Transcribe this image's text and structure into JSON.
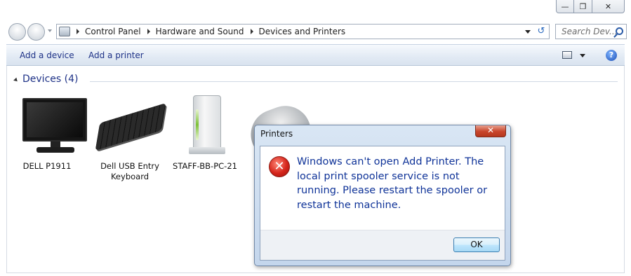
{
  "breadcrumb": [
    "Control Panel",
    "Hardware and Sound",
    "Devices and Printers"
  ],
  "search": {
    "placeholder": "Search Dev..."
  },
  "toolbar": {
    "add_device": "Add a device",
    "add_printer": "Add a printer"
  },
  "group": {
    "header": "Devices (4)"
  },
  "devices": [
    {
      "label": "DELL P1911",
      "icon": "monitor-icon"
    },
    {
      "label": "Dell USB Entry Keyboard",
      "icon": "keyboard-icon"
    },
    {
      "label": "STAFF-BB-PC-21",
      "icon": "computer-drive-icon"
    },
    {
      "label": "",
      "icon": "mouse-icon"
    }
  ],
  "dialog": {
    "title": "Printers",
    "message": "Windows can't open Add Printer. The local print spooler service is not running. Please restart the spooler or restart the machine.",
    "ok_label": "OK",
    "icon": "error-icon"
  },
  "colors": {
    "link_blue": "#1e3287",
    "message_blue": "#0f3398",
    "error_red": "#d5251b"
  }
}
